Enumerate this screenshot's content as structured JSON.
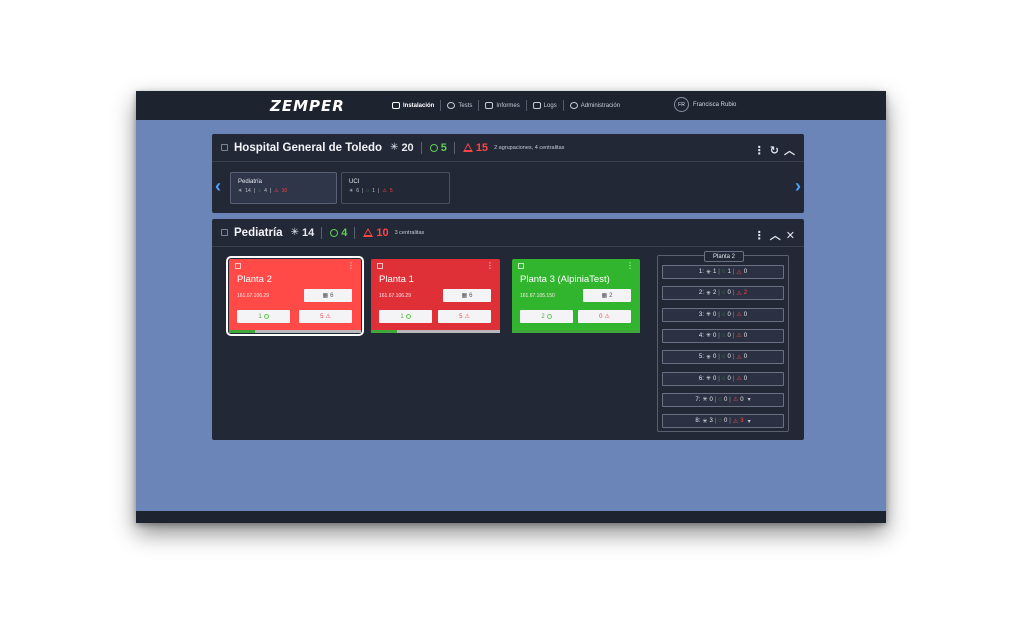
{
  "app": {
    "logo": "ZEMPER"
  },
  "nav": [
    {
      "label": "Instalación",
      "active": true
    },
    {
      "label": "Tests",
      "active": false
    },
    {
      "label": "Informes",
      "active": false
    },
    {
      "label": "Logs",
      "active": false
    },
    {
      "label": "Administración",
      "active": false
    }
  ],
  "user": {
    "initials": "FR",
    "name": "Francisca Rubio"
  },
  "hospital": {
    "title": "Hospital General de Toledo",
    "total": "20",
    "ok": "5",
    "alerts": "15",
    "meta": "2 agrupaciones, 4 centralitas",
    "groups": [
      {
        "name": "Pediatría",
        "total": "14",
        "ok": "4",
        "alerts": "10"
      },
      {
        "name": "UCI",
        "total": "6",
        "ok": "1",
        "alerts": "5"
      }
    ]
  },
  "pediatria": {
    "title": "Pediatría",
    "total": "14",
    "ok": "4",
    "alerts": "10",
    "meta": "3 centralitas",
    "cards": [
      {
        "title": "Planta 2",
        "ip": "161.67.106.29",
        "devices": "6",
        "ok": "1",
        "alerts": "5",
        "ok_fraction": 0.2
      },
      {
        "title": "Planta 1",
        "ip": "161.67.106.29",
        "devices": "6",
        "ok": "1",
        "alerts": "5",
        "ok_fraction": 0.2
      },
      {
        "title": "Planta 3 (AlpiniaTest)",
        "ip": "161.67.105.150",
        "devices": "2",
        "ok": "2",
        "alerts": "0",
        "ok_fraction": 1.0
      }
    ],
    "floors_title": "Planta 2",
    "floors": [
      {
        "n": "1:",
        "total": "1",
        "ok": "1",
        "alerts": "0",
        "dropdown": false
      },
      {
        "n": "2:",
        "total": "2",
        "ok": "0",
        "alerts": "2",
        "dropdown": false
      },
      {
        "n": "3:",
        "total": "0",
        "ok": "0",
        "alerts": "0",
        "dropdown": false
      },
      {
        "n": "4:",
        "total": "0",
        "ok": "0",
        "alerts": "0",
        "dropdown": false
      },
      {
        "n": "5:",
        "total": "0",
        "ok": "0",
        "alerts": "0",
        "dropdown": false
      },
      {
        "n": "6:",
        "total": "0",
        "ok": "0",
        "alerts": "0",
        "dropdown": false
      },
      {
        "n": "7:",
        "total": "0",
        "ok": "0",
        "alerts": "0",
        "dropdown": true
      },
      {
        "n": "8:",
        "total": "3",
        "ok": "0",
        "alerts": "3",
        "dropdown": true
      }
    ]
  },
  "colors": {
    "card_red": "#ff4a48",
    "card_red_dark": "#e03037",
    "card_green": "#32b52e",
    "accent": "#4aa3ff",
    "ok": "#5fcf55",
    "alert": "#ff4444"
  }
}
